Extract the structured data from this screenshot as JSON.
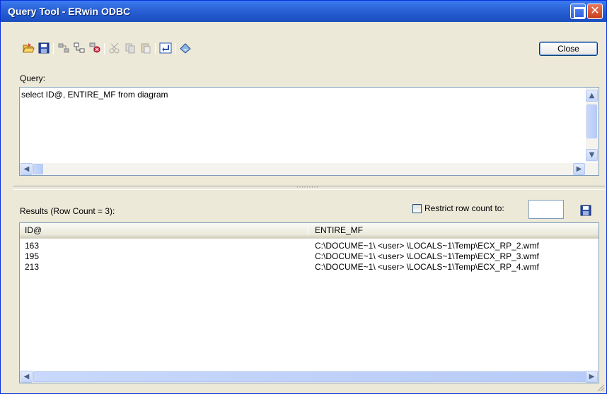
{
  "window": {
    "title": "Query Tool - ERwin ODBC"
  },
  "toolbar": {
    "icons": [
      "open-icon",
      "save-icon",
      "connect-icon",
      "schema-icon",
      "disconnect-icon",
      "cut-icon",
      "copy-icon",
      "paste-icon",
      "execute-icon",
      "clear-icon"
    ],
    "close_label": "Close"
  },
  "query": {
    "label": "Query:",
    "text": "select ID@, ENTIRE_MF from diagram"
  },
  "results": {
    "label": "Results (Row Count = 3):",
    "restrict_label": "Restrict row count to:",
    "restrict_checked": false,
    "restrict_value": "",
    "columns": [
      "ID@",
      "ENTIRE_MF"
    ],
    "rows": [
      [
        "163",
        "C:\\DOCUME~1\\  <user>  \\LOCALS~1\\Temp\\ECX_RP_2.wmf"
      ],
      [
        "195",
        "C:\\DOCUME~1\\  <user>  \\LOCALS~1\\Temp\\ECX_RP_3.wmf"
      ],
      [
        "213",
        "C:\\DOCUME~1\\  <user>  \\LOCALS~1\\Temp\\ECX_RP_4.wmf"
      ]
    ]
  },
  "colors": {
    "titlebar": "#2258cc",
    "window_bg": "#ece9d8",
    "border": "#7f9db9"
  }
}
